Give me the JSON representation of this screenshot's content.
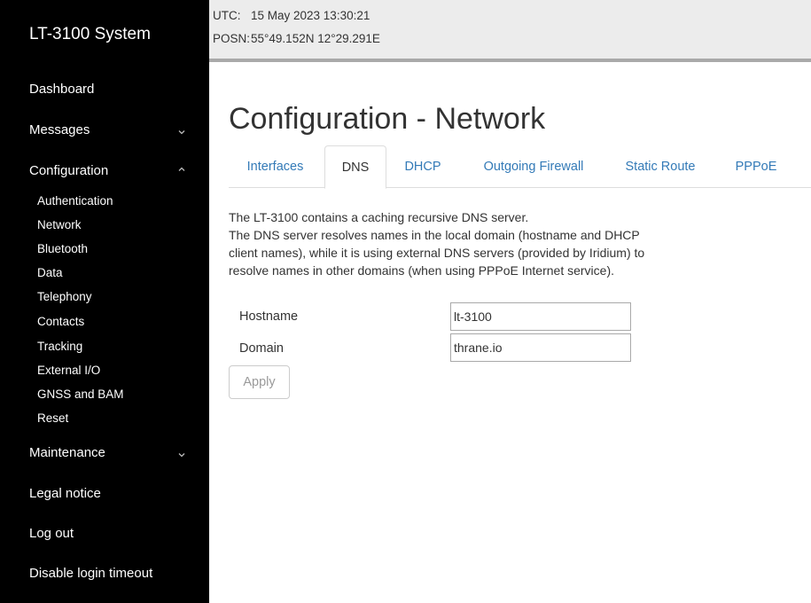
{
  "app": {
    "title": "LT-3100 System"
  },
  "status": {
    "utc_label": "UTC:",
    "utc_value": "15 May 2023 13:30:21",
    "posn_label": "POSN:",
    "posn_value": "55°49.152N 12°29.291E"
  },
  "sidebar": {
    "dashboard": "Dashboard",
    "messages": "Messages",
    "configuration": "Configuration",
    "config_items": [
      "Authentication",
      "Network",
      "Bluetooth",
      "Data",
      "Telephony",
      "Contacts",
      "Tracking",
      "External I/O",
      "GNSS and BAM",
      "Reset"
    ],
    "maintenance": "Maintenance",
    "legal": "Legal notice",
    "logout": "Log out",
    "disable_timeout": "Disable login timeout"
  },
  "page": {
    "title": "Configuration - Network"
  },
  "tabs": [
    "Interfaces",
    "DNS",
    "DHCP",
    "Outgoing Firewall",
    "Static Route",
    "PPPoE"
  ],
  "active_tab": "DNS",
  "description": [
    "The LT-3100 contains a caching recursive DNS server.",
    "The DNS server resolves names in the local domain (hostname and DHCP",
    "client names), while it is using external DNS servers (provided by Iridium) to",
    "resolve names in other domains (when using PPPoE Internet service)."
  ],
  "form": {
    "hostname_label": "Hostname",
    "hostname_value": "lt-3100",
    "domain_label": "Domain",
    "domain_value": "thrane.io",
    "apply_label": "Apply"
  },
  "colors": {
    "sidebar_bg": "#000000",
    "link": "#337ab7",
    "topbar_bg": "#ececec"
  }
}
